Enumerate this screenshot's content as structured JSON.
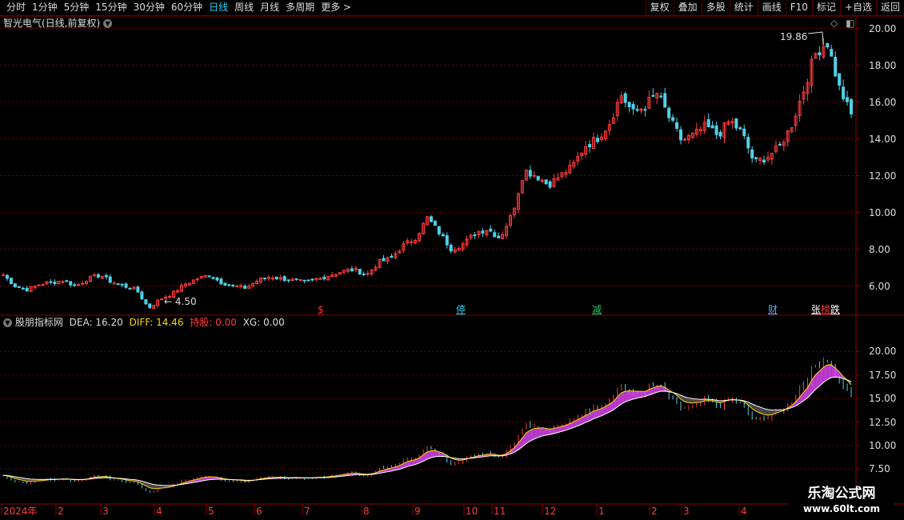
{
  "toolbar": {
    "periods": [
      "分时",
      "1分钟",
      "5分钟",
      "15分钟",
      "30分钟",
      "60分钟",
      "日线",
      "周线",
      "月线",
      "多周期",
      "更多 >"
    ],
    "active_period": "日线",
    "buttons": [
      "复权",
      "叠加",
      "多股",
      "统计",
      "画线",
      "F10",
      "标记",
      "+自选",
      "返回"
    ]
  },
  "main_panel": {
    "title": "智光电气(日线,前复权)",
    "high_label": "19.86",
    "low_label": "4.50",
    "y_ticks": [
      "20.00",
      "18.00",
      "16.00",
      "14.00",
      "12.00",
      "10.00",
      "8.00",
      "6.00"
    ],
    "markers": [
      {
        "text": "$",
        "color": "#ff3030"
      },
      {
        "text": "停",
        "color": "#22d3ee"
      },
      {
        "text": "减",
        "color": "#22c55e"
      },
      {
        "text": "财",
        "color": "#60a5fa"
      },
      {
        "text": "张",
        "color": "#ffffff"
      },
      {
        "text": "榜",
        "color": "#ff3030"
      },
      {
        "text": "跌",
        "color": "#ffffff"
      }
    ]
  },
  "indicator_panel": {
    "name": "股朋指标网",
    "dea_label": "DEA:",
    "dea_value": "16.20",
    "diff_label": "DIFF:",
    "diff_value": "14.46",
    "hold_label": "持股:",
    "hold_value": "0.00",
    "xg_label": "XG:",
    "xg_value": "0.00",
    "y_ticks": [
      "20.00",
      "17.50",
      "15.00",
      "12.50",
      "10.00",
      "7.50"
    ]
  },
  "x_axis": {
    "labels": [
      "2024年",
      "2",
      "3",
      "4",
      "5",
      "6",
      "7",
      "8",
      "9",
      "10",
      "11",
      "12",
      "1",
      "2",
      "3",
      "4"
    ]
  },
  "watermark": {
    "line1": "乐淘公式网",
    "line2": "www.60lt.com"
  },
  "colors": {
    "up": "#ff3b3b",
    "down": "#4fd1e8",
    "diff_line": "#ffd700",
    "dea_line": "#ffffff",
    "band_up": "#d946ef",
    "band_down": "#555555",
    "grid": "#6b0000",
    "axis": "#8b0000"
  },
  "chart_data": {
    "type": "candlestick",
    "x": [
      "2024-01",
      "2024-02",
      "2024-03",
      "2024-04",
      "2024-05",
      "2024-06",
      "2024-07",
      "2024-08",
      "2024-09",
      "2024-10",
      "2024-11",
      "2024-12",
      "2025-01",
      "2025-02",
      "2025-03",
      "2025-04"
    ],
    "close_path": [
      6.6,
      6.0,
      5.8,
      6.1,
      6.2,
      6.3,
      6.0,
      6.4,
      6.6,
      6.2,
      6.0,
      5.8,
      4.8,
      5.3,
      5.6,
      6.1,
      6.4,
      6.6,
      6.2,
      6.0,
      5.9,
      6.3,
      6.5,
      6.4,
      6.3,
      6.2,
      6.4,
      6.6,
      6.8,
      6.9,
      6.6,
      7.3,
      7.5,
      8.2,
      8.6,
      9.7,
      8.9,
      8.0,
      8.3,
      8.9,
      9.1,
      8.6,
      9.9,
      12.3,
      12.0,
      11.5,
      12.0,
      12.5,
      13.6,
      14.0,
      14.8,
      16.4,
      15.4,
      15.8,
      16.5,
      15.1,
      13.9,
      14.2,
      14.7,
      14.2,
      15.0,
      14.3,
      12.7,
      13.0,
      13.5,
      14.6,
      16.5,
      18.6,
      19.3,
      16.8,
      15.3
    ],
    "high": 19.86,
    "low": 4.5,
    "ylim_main": [
      4.5,
      20.5
    ],
    "indicator": {
      "dea": 16.2,
      "diff": 14.46,
      "hold": 0,
      "xg": 0,
      "ylim": [
        6.5,
        22.5
      ]
    }
  }
}
